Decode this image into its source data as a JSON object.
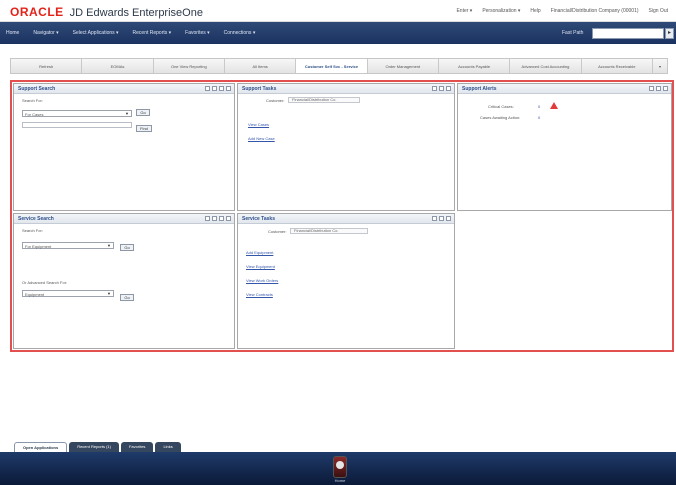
{
  "header": {
    "brand": "ORACLE",
    "product": "JD Edwards EnterpriseOne",
    "links": [
      "Enter ▾",
      "Personalization ▾",
      "Help",
      "Financial/Distribution Company (00001)",
      "Sign Out"
    ]
  },
  "nav": {
    "items": [
      "Home",
      "Navigator ▾",
      "Select Applications ▾",
      "Recent Reports ▾",
      "Favorites ▾",
      "Connections ▾"
    ],
    "fastpath_label": "Fast Path",
    "fastpath_value": "",
    "go_label": "▸"
  },
  "tabs": [
    {
      "label": "Refresh",
      "active": false
    },
    {
      "label": "EOMAs",
      "active": false
    },
    {
      "label": "One View Reporting",
      "active": false
    },
    {
      "label": "All Items",
      "active": false
    },
    {
      "label": "Customer Self Svc - Service",
      "active": true
    },
    {
      "label": "Order Management",
      "active": false
    },
    {
      "label": "Accounts Payable",
      "active": false
    },
    {
      "label": "Advanced Cost Accounting",
      "active": false
    },
    {
      "label": "Accounts Receivable",
      "active": false
    }
  ],
  "portlets": {
    "support_search": {
      "title": "Support Search",
      "search_for_label": "Search For:",
      "search_for_value": "For Cases",
      "go_label": "Go",
      "find_label": "Find"
    },
    "support_tasks": {
      "title": "Support Tasks",
      "customer_label": "Customer:",
      "customer_value": "Financial/Distribution Co.",
      "links": [
        "View Cases",
        "Add New Case"
      ]
    },
    "support_alerts": {
      "title": "Support Alerts",
      "rows": [
        {
          "label": "Critical Cases:",
          "value": "0"
        },
        {
          "label": "Cases Awaiting Action:",
          "value": "0"
        }
      ]
    },
    "service_search": {
      "title": "Service Search",
      "search_for_label": "Search For:",
      "search_for_value": "For Equipment",
      "go_label": "Go",
      "advanced_label": "Or Advanced Search For:",
      "advanced_value": "Equipment",
      "go2_label": "Go"
    },
    "service_tasks": {
      "title": "Service Tasks",
      "customer_label": "Customer:",
      "customer_value": "Financial/Distribution Co.",
      "links": [
        "Add Equipment",
        "View Equipment",
        "View Work Orders",
        "View Contracts"
      ]
    }
  },
  "bottom_tabs": [
    {
      "label": "Open Applications",
      "active": true
    },
    {
      "label": "Recent Reports (1)",
      "active": false
    },
    {
      "label": "Favorites",
      "active": false
    },
    {
      "label": "Links",
      "active": false
    }
  ],
  "footer": {
    "label": "Home"
  }
}
